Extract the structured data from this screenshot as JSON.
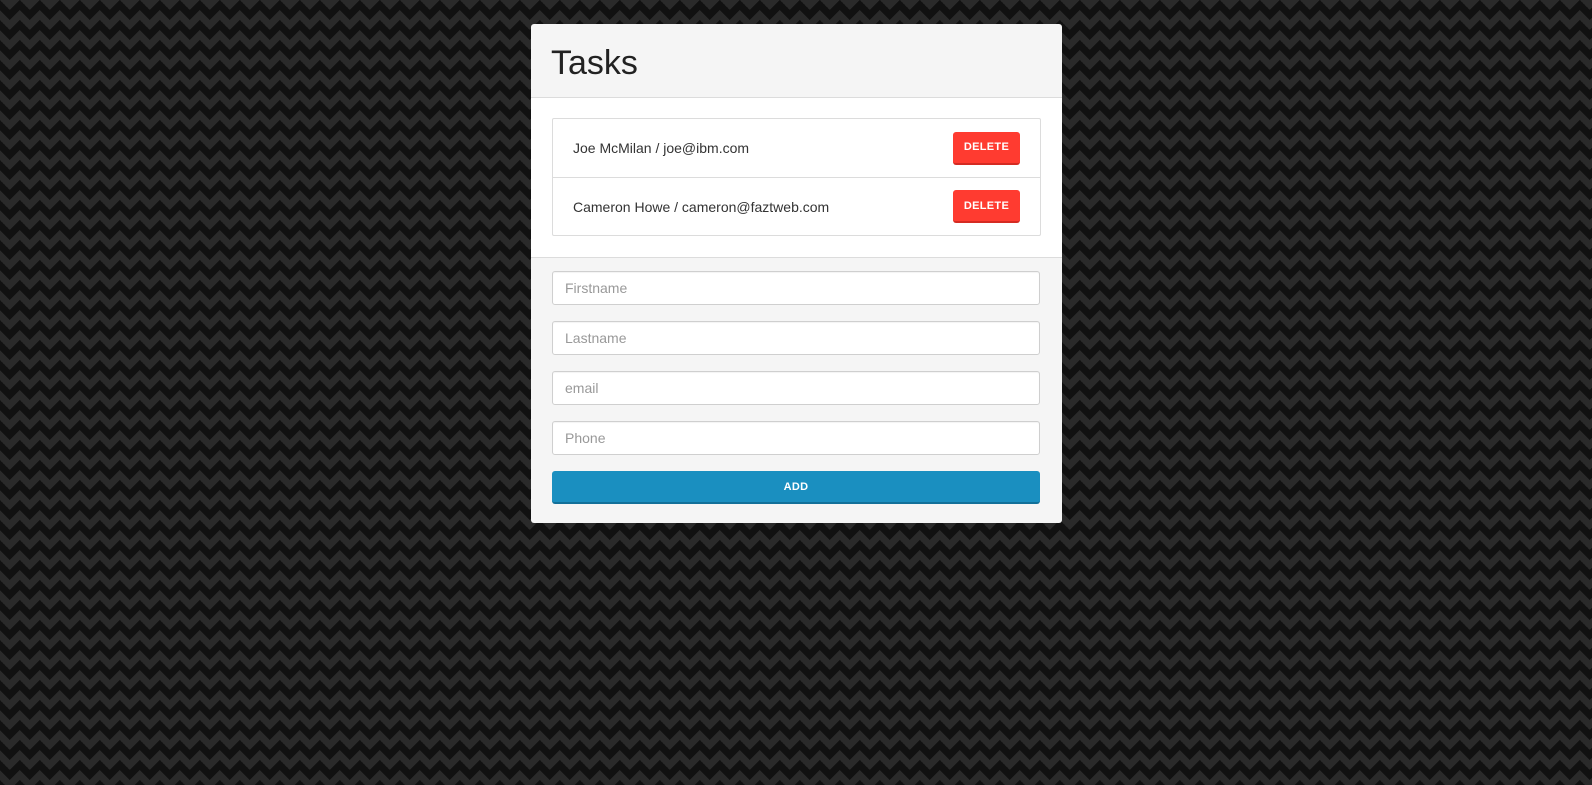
{
  "panel": {
    "title": "Tasks"
  },
  "tasks": [
    {
      "text": "Joe McMilan / joe@ibm.com",
      "delete_label": "DELETE"
    },
    {
      "text": "Cameron Howe / cameron@faztweb.com",
      "delete_label": "DELETE"
    }
  ],
  "form": {
    "firstname_placeholder": "Firstname",
    "lastname_placeholder": "Lastname",
    "email_placeholder": "email",
    "phone_placeholder": "Phone",
    "add_label": "ADD"
  },
  "colors": {
    "delete": "#ff3b30",
    "add": "#1a8fc0"
  }
}
